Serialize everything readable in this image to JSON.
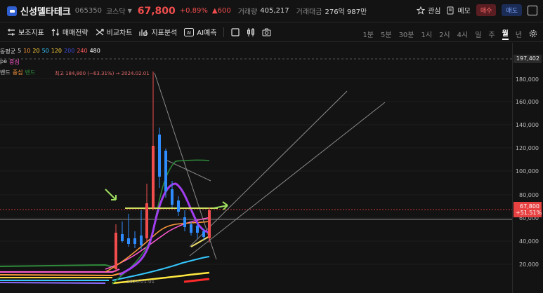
{
  "header": {
    "name": "신성델타테크",
    "code": "065350",
    "market": "코스닥",
    "price": "67,800",
    "change_pct": "+0.89%",
    "change_abs": "▲600",
    "volume_label": "거래량",
    "volume": "405,217",
    "amount_label": "거래대금",
    "amount": "276억 987만",
    "watch_label": "관심",
    "memo_label": "메모",
    "buy_label": "매수",
    "sell_label": "매도"
  },
  "toolbar": {
    "indicators": "보조지표",
    "strategy": "매매전략",
    "compare": "비교차트",
    "analysis": "지표분석",
    "ai": "AI예측",
    "periods": [
      "1분",
      "5분",
      "30분",
      "1시",
      "2시",
      "4시",
      "일",
      "주",
      "월",
      "년"
    ],
    "active_period": "월"
  },
  "legend": {
    "ma_label": "동평균",
    "ma_periods": [
      "5",
      "10",
      "20",
      "50",
      "120",
      "200",
      "240",
      "480"
    ],
    "ma_colors": [
      "#e0e0e0",
      "#ff9a3c",
      "#ffd23f",
      "#35c8ff",
      "#5b8cff",
      "#3b4bd6",
      "#ff5a5a",
      "#ffffff"
    ],
    "line2_name": "pe",
    "line2_value": "중심",
    "line3_name": "밴드",
    "line3_center": "중심",
    "line3_band": "밴드"
  },
  "chart": {
    "max_note": "최고 184,800 (−63.31%) → 2024.02.01",
    "date_note": "2023.01.01",
    "price_axis": [
      "180,000",
      "160,000",
      "140,000",
      "120,000",
      "100,000",
      "80,000",
      "60,000",
      "40,000",
      "20,000"
    ],
    "max_tag": "197,402",
    "current_tag_price": "67,800",
    "current_tag_pct": "+51.51%"
  },
  "colors": {
    "up": "#f24d4d",
    "down": "#2f8cff",
    "background": "#131313"
  }
}
